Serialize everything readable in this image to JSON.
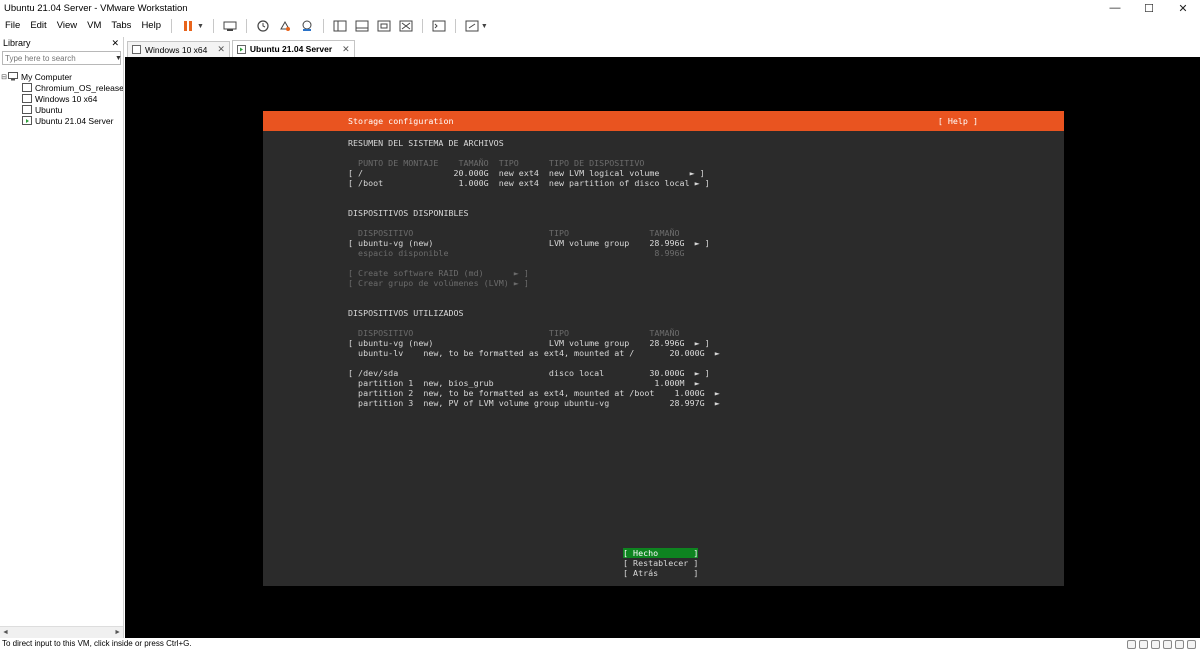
{
  "window": {
    "title": "Ubuntu 21.04 Server - VMware Workstation",
    "minimize": "—",
    "maximize": "☐",
    "close": "✕"
  },
  "menu": [
    "File",
    "Edit",
    "View",
    "VM",
    "Tabs",
    "Help"
  ],
  "library": {
    "header": "Library",
    "close": "✕",
    "search_placeholder": "Type here to search",
    "tree": {
      "root": "My Computer",
      "items": [
        "Chromium_OS_release-l",
        "Windows 10 x64",
        "Ubuntu",
        "Ubuntu 21.04 Server"
      ]
    }
  },
  "tabs": [
    {
      "label": "Windows 10 x64",
      "active": false
    },
    {
      "label": "Ubuntu 21.04 Server",
      "active": true
    }
  ],
  "console": {
    "header_title": "Storage configuration",
    "header_help": "[ Help ]",
    "summary": {
      "title": "RESUMEN DEL SISTEMA DE ARCHIVOS",
      "columns": "  PUNTO DE MONTAJE    TAMAÑO  TIPO      TIPO DE DISPOSITIVO",
      "rows": [
        "[ /                  20.000G  new ext4  new LVM logical volume      ► ]",
        "[ /boot               1.000G  new ext4  new partition of disco local ► ]"
      ]
    },
    "available": {
      "title": "DISPOSITIVOS DISPONIBLES",
      "columns": "  DISPOSITIVO                           TIPO                TAMAÑO",
      "device_row": "[ ubuntu-vg (new)                       LVM volume group    28.996G  ► ]",
      "free_row": "  espacio disponible                                         8.996G",
      "actions": [
        "[ Create software RAID (md)      ► ]",
        "[ Crear grupo de volúmenes (LVM) ► ]"
      ]
    },
    "used": {
      "title": "DISPOSITIVOS UTILIZADOS",
      "columns": "  DISPOSITIVO                           TIPO                TAMAÑO",
      "vg_rows": [
        "[ ubuntu-vg (new)                       LVM volume group    28.996G  ► ]",
        "  ubuntu-lv    new, to be formatted as ext4, mounted at /       20.000G  ►"
      ],
      "disk_rows": [
        "[ /dev/sda                              disco local         30.000G  ► ]",
        "  partition 1  new, bios_grub                                1.000M  ►",
        "  partition 2  new, to be formatted as ext4, mounted at /boot    1.000G  ►",
        "  partition 3  new, PV of LVM volume group ubuntu-vg            28.997G  ►"
      ]
    },
    "buttons": {
      "done": "[ Hecho       ]",
      "reset": "[ Restablecer ]",
      "back": "[ Atrás       ]"
    }
  },
  "status": {
    "message": "To direct input to this VM, click inside or press Ctrl+G."
  }
}
